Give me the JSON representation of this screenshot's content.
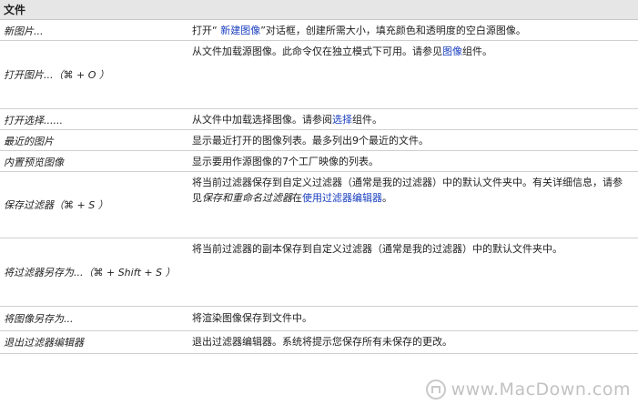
{
  "section_title": "文件",
  "rows": [
    {
      "command": "新图片...",
      "desc": [
        {
          "t": "打开“ "
        },
        {
          "t": "新建图像",
          "link": true
        },
        {
          "t": "”对话框，创建所需大小，填充颜色和透明度的空白源图像。"
        }
      ]
    },
    {
      "command": "打开图片...（⌘ + O ）",
      "desc": [
        {
          "t": "从文件加载源图像。此命令仅在独立模式下可用。请参见"
        },
        {
          "t": "图像",
          "link": true
        },
        {
          "t": "组件。"
        }
      ]
    },
    {
      "command": "打开选择......",
      "desc": [
        {
          "t": "从文件中加载选择图像。请参阅"
        },
        {
          "t": "选择",
          "link": true
        },
        {
          "t": "组件。"
        }
      ]
    },
    {
      "command": "最近的图片",
      "desc": [
        {
          "t": "显示最近打开的图像列表。最多列出9个最近的文件。"
        }
      ]
    },
    {
      "command": "内置预览图像",
      "desc": [
        {
          "t": "显示要用作源图像的7个工厂映像的列表。"
        }
      ]
    },
    {
      "command": "保存过滤器（⌘ + S ）",
      "desc": [
        {
          "t": "将当前过滤器保存到自定义过滤器（通常是我的过滤器）中的默认文件夹中。有关详细信息，请参见"
        },
        {
          "t": "保存和重命名过滤器",
          "em": true
        },
        {
          "t": "在"
        },
        {
          "t": "使用过滤器编辑器",
          "link": true
        },
        {
          "t": "。"
        }
      ]
    },
    {
      "command": "将过滤器另存为...（⌘ + Shift + S ）",
      "desc": [
        {
          "t": "将当前过滤器的副本保存到自定义过滤器（通常是我的过滤器）中的默认文件夹中。"
        }
      ]
    },
    {
      "command": "将图像另存为...",
      "desc": [
        {
          "t": "将渲染图像保存到文件中。"
        }
      ]
    },
    {
      "command": "退出过滤器编辑器",
      "desc": [
        {
          "t": "退出过滤器编辑器。系统将提示您保存所有未保存的更改。"
        }
      ]
    }
  ],
  "watermark": "www.MacDown.com"
}
